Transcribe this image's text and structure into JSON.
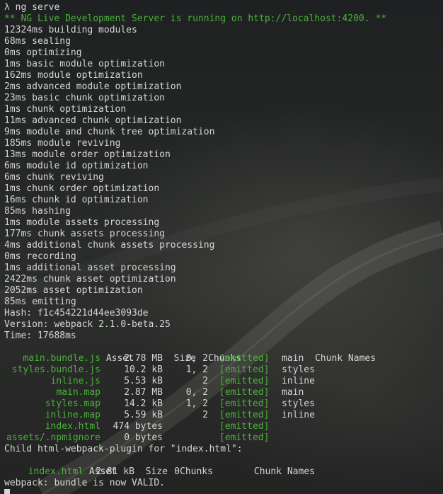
{
  "terminal": {
    "prompt_symbol": "λ",
    "command": "ng serve",
    "banner": "** NG Live Development Server is running on http://localhost:4200. **",
    "build_lines": [
      "12324ms building modules",
      "68ms sealing",
      "0ms optimizing",
      "1ms basic module optimization",
      "162ms module optimization",
      "2ms advanced module optimization",
      "23ms basic chunk optimization",
      "1ms chunk optimization",
      "11ms advanced chunk optimization",
      "9ms module and chunk tree optimization",
      "185ms module reviving",
      "13ms module order optimization",
      "6ms module id optimization",
      "6ms chunk reviving",
      "1ms chunk order optimization",
      "16ms chunk id optimization",
      "85ms hashing",
      "1ms module assets processing",
      "177ms chunk assets processing",
      "4ms additional chunk assets processing",
      "0ms recording",
      "1ms additional asset processing",
      "2422ms chunk asset optimization",
      "2052ms asset optimization",
      "85ms emitting"
    ],
    "hash_label": "Hash: ",
    "hash_value": "f1c454221d44ee3093de",
    "version_label": "Version: webpack ",
    "version_value": "2.1.0-beta.25",
    "time_label": "Time: ",
    "time_value": "17688ms",
    "asset_headers": [
      "Asset",
      "Size",
      "Chunks",
      "",
      "Chunk Names"
    ],
    "assets": [
      {
        "asset": "main.bundle.js",
        "size": "2.78 MB",
        "chunks": "0, 2",
        "status": "[emitted]",
        "name": "main"
      },
      {
        "asset": "styles.bundle.js",
        "size": "10.2 kB",
        "chunks": "1, 2",
        "status": "[emitted]",
        "name": "styles"
      },
      {
        "asset": "inline.js",
        "size": "5.53 kB",
        "chunks": "2",
        "status": "[emitted]",
        "name": "inline"
      },
      {
        "asset": "main.map",
        "size": "2.87 MB",
        "chunks": "0, 2",
        "status": "[emitted]",
        "name": "main"
      },
      {
        "asset": "styles.map",
        "size": "14.2 kB",
        "chunks": "1, 2",
        "status": "[emitted]",
        "name": "styles"
      },
      {
        "asset": "inline.map",
        "size": "5.59 kB",
        "chunks": "2",
        "status": "[emitted]",
        "name": "inline"
      },
      {
        "asset": "index.html",
        "size": "474 bytes",
        "chunks": "",
        "status": "[emitted]",
        "name": ""
      },
      {
        "asset": "assets/.npmignore",
        "size": "0 bytes",
        "chunks": "",
        "status": "[emitted]",
        "name": ""
      }
    ],
    "child_line": "Child html-webpack-plugin for \"index.html\":",
    "child_headers": [
      "Asset",
      "Size",
      "Chunks",
      "Chunk Names"
    ],
    "child_assets": [
      {
        "asset": "index.html",
        "size": "2.81 kB",
        "chunks": "0",
        "name": ""
      }
    ],
    "final_line": "webpack: bundle is now VALID.",
    "colors": {
      "background": "#222426",
      "text": "#d6d6d6",
      "green": "#4ab23a"
    }
  }
}
